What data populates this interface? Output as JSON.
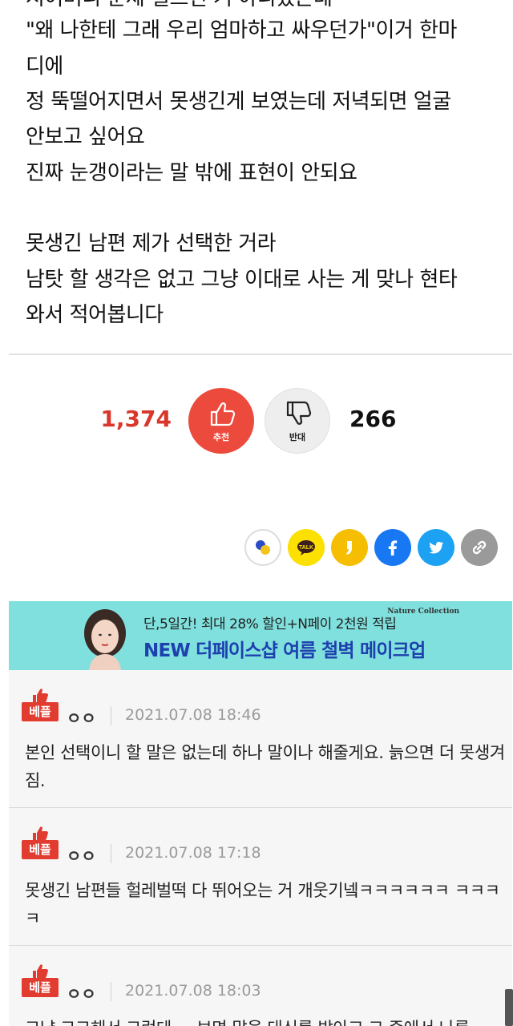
{
  "article": {
    "partial_top_line": "시어머니 문제 일으킨 거 아니었는데",
    "lines": [
      "\"왜 나한테 그래 우리 엄마하고 싸우던가\"이거 한마",
      "디에",
      "정 뚝떨어지면서 못생긴게 보였는데 저녁되면 얼굴",
      "안보고 싶어요",
      "진짜 눈갱이라는 말 밖에 표현이 안되요",
      "",
      "못생긴 남편 제가 선택한 거라",
      "남탓 할 생각은 없고 그냥 이대로 사는 게 맞나 현타",
      "와서 적어봅니다"
    ]
  },
  "votes": {
    "up_count": "1,374",
    "up_label": "추천",
    "down_label": "반대",
    "down_count": "266",
    "up_color": "#ec4a3c"
  },
  "share": {
    "icons": [
      "band-icon",
      "kakaotalk-icon",
      "kakaostory-icon",
      "facebook-icon",
      "twitter-icon",
      "link-icon"
    ],
    "talk_label": "TALK"
  },
  "ad": {
    "brand_tag": "Nature Collection",
    "line1": "단,5일간! 최대 28% 할인+N페이 2천원 적립",
    "line2": "NEW 더페이스샵 여름 철벽 메이크업",
    "bg": "#7fe0dd"
  },
  "comments": [
    {
      "badge": "베플",
      "author": "ㅇㅇ",
      "date": "2021.07.08 18:46",
      "body": "본인 선택이니 할 말은 없는데 하나 말이나 해줄게요. 늙으면 더 못생겨짐."
    },
    {
      "badge": "베플",
      "author": "ㅇㅇ",
      "date": "2021.07.08 17:18",
      "body": "못생긴 남편들 헐레벌떡 다 뛰어오는 거 개웃기넼ㅋㅋㅋㅋㅋㅋ ㅋㅋㅋㅋ"
    },
    {
      "badge": "베플",
      "author": "ㅇㅇ",
      "date": "2021.07.08 18:03",
      "body": "그냥 그그해서 그런데 ... 보면 말을 대신를 받아고 그 중에서 나름"
    }
  ]
}
